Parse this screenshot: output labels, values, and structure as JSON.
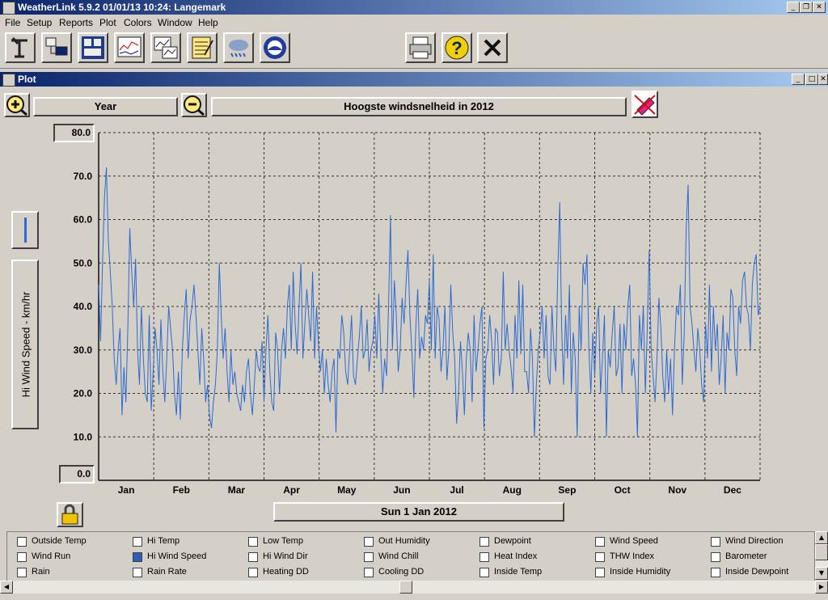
{
  "window": {
    "title": "WeatherLink 5.9.2  01/01/13  10:24: Langemark",
    "min": "_",
    "max": "❐",
    "close": "✕"
  },
  "menu": [
    "File",
    "Setup",
    "Reports",
    "Plot",
    "Colors",
    "Window",
    "Help"
  ],
  "toolbar": {
    "icons": [
      "station-icon",
      "download-icon",
      "bulletin-icon",
      "strip-chart-icon",
      "plot-icon",
      "notepad-icon",
      "weather-clouds-icon",
      "noaa-icon"
    ],
    "right_icons": [
      "print-icon",
      "help-icon",
      "close-icon"
    ]
  },
  "plot_window": {
    "title": "Plot",
    "min": "_",
    "max": "□",
    "close": "✕",
    "span_label": "Year",
    "chart_title": "Hoogste windsnelheid in 2012",
    "date_label": "Sun 1 Jan 2012"
  },
  "chart_data": {
    "type": "line",
    "title": "Hoogste windsnelheid in 2012",
    "ylabel": "Hi Wind Speed - km/hr",
    "ylim": [
      0,
      80
    ],
    "ymin_label": "0.0",
    "ymax_label": "80.0",
    "yticks": [
      "70.0",
      "60.0",
      "50.0",
      "40.0",
      "30.0",
      "20.0",
      "10.0"
    ],
    "categories": [
      "Jan",
      "Feb",
      "Mar",
      "Apr",
      "May",
      "Jun",
      "Jul",
      "Aug",
      "Sep",
      "Oct",
      "Nov",
      "Dec"
    ],
    "grid": true,
    "color": "#2e6ad0",
    "series": [
      {
        "values": [
          45,
          32,
          50,
          65,
          72,
          55,
          48,
          40,
          28,
          22,
          30,
          35,
          15,
          26,
          18,
          35,
          58,
          48,
          40,
          51,
          30,
          22,
          40,
          28,
          20,
          18,
          38,
          16,
          25,
          35,
          30,
          22,
          37,
          25,
          18,
          28,
          40,
          35,
          30,
          20,
          15,
          25,
          14,
          30,
          38,
          44,
          28,
          37,
          40,
          45,
          38,
          30,
          22,
          35,
          28,
          18,
          22,
          15,
          12,
          18,
          22,
          30,
          50,
          38,
          28,
          35,
          25,
          18,
          30,
          22,
          25,
          20,
          18,
          16,
          22,
          18,
          25,
          28,
          20,
          15,
          22,
          30,
          26,
          25,
          32,
          18,
          30,
          38,
          25,
          18,
          16,
          34,
          30,
          20,
          30,
          35,
          28,
          40,
          45,
          30,
          48,
          36,
          29,
          40,
          50,
          28,
          36,
          44,
          38,
          32,
          48,
          28,
          40,
          31,
          25,
          30,
          20,
          28,
          22,
          18,
          25,
          28,
          11,
          30,
          28,
          38,
          34,
          25,
          22,
          30,
          38,
          24,
          22,
          28,
          33,
          40,
          28,
          30,
          37,
          25,
          30,
          32,
          38,
          28,
          43,
          30,
          20,
          28,
          24,
          40,
          61,
          30,
          46,
          38,
          25,
          30,
          42,
          36,
          45,
          53,
          38,
          30,
          19,
          35,
          44,
          28,
          33,
          30,
          38,
          36,
          46,
          30,
          52,
          28,
          40,
          37,
          25,
          30,
          40,
          23,
          30,
          45,
          34,
          28,
          13,
          20,
          32,
          25,
          15,
          28,
          34,
          30,
          18,
          38,
          25,
          30,
          36,
          40,
          12,
          28,
          30,
          38,
          32,
          22,
          35,
          34,
          24,
          28,
          48,
          30,
          36,
          30,
          26,
          20,
          38,
          28,
          46,
          29,
          45,
          25,
          25,
          20,
          35,
          28,
          10,
          22,
          30,
          34,
          40,
          28,
          38,
          24,
          22,
          40,
          30,
          25,
          48,
          64,
          35,
          22,
          38,
          28,
          45,
          20,
          34,
          28,
          10,
          40,
          30,
          50,
          45,
          52,
          30,
          20,
          34,
          24,
          36,
          40,
          20,
          28,
          38,
          10,
          30,
          26,
          34,
          40,
          24,
          26,
          36,
          20,
          36,
          30,
          40,
          45,
          24,
          28,
          22,
          10,
          38,
          30,
          40,
          20,
          35,
          53,
          30,
          24,
          18,
          28,
          42,
          35,
          24,
          18,
          30,
          20,
          28,
          15,
          30,
          40,
          38,
          45,
          22,
          34,
          58,
          68,
          40,
          36,
          30,
          25,
          35,
          30,
          22,
          18,
          36,
          28,
          45,
          25,
          40,
          30,
          36,
          22,
          28,
          38,
          20,
          34,
          30,
          44,
          42,
          30,
          24,
          40,
          36,
          46,
          48,
          40,
          38,
          30,
          45,
          50,
          52,
          38,
          40
        ]
      }
    ]
  },
  "checkboxes": [
    [
      {
        "label": "Outside Temp",
        "checked": false
      },
      {
        "label": "Hi Temp",
        "checked": false
      },
      {
        "label": "Low Temp",
        "checked": false
      },
      {
        "label": "Out Humidity",
        "checked": false
      },
      {
        "label": "Dewpoint",
        "checked": false
      },
      {
        "label": "Wind Speed",
        "checked": false
      },
      {
        "label": "Wind Direction",
        "checked": false
      }
    ],
    [
      {
        "label": "Wind Run",
        "checked": false
      },
      {
        "label": "Hi Wind Speed",
        "checked": true
      },
      {
        "label": "Hi Wind Dir",
        "checked": false
      },
      {
        "label": "Wind Chill",
        "checked": false
      },
      {
        "label": "Heat Index",
        "checked": false
      },
      {
        "label": "THW Index",
        "checked": false
      },
      {
        "label": "Barometer",
        "checked": false
      }
    ],
    [
      {
        "label": "Rain",
        "checked": false
      },
      {
        "label": "Rain Rate",
        "checked": false
      },
      {
        "label": "Heating DD",
        "checked": false
      },
      {
        "label": "Cooling DD",
        "checked": false
      },
      {
        "label": "Inside Temp",
        "checked": false
      },
      {
        "label": "Inside Humidity",
        "checked": false
      },
      {
        "label": "Inside Dewpoint",
        "checked": false
      }
    ]
  ]
}
